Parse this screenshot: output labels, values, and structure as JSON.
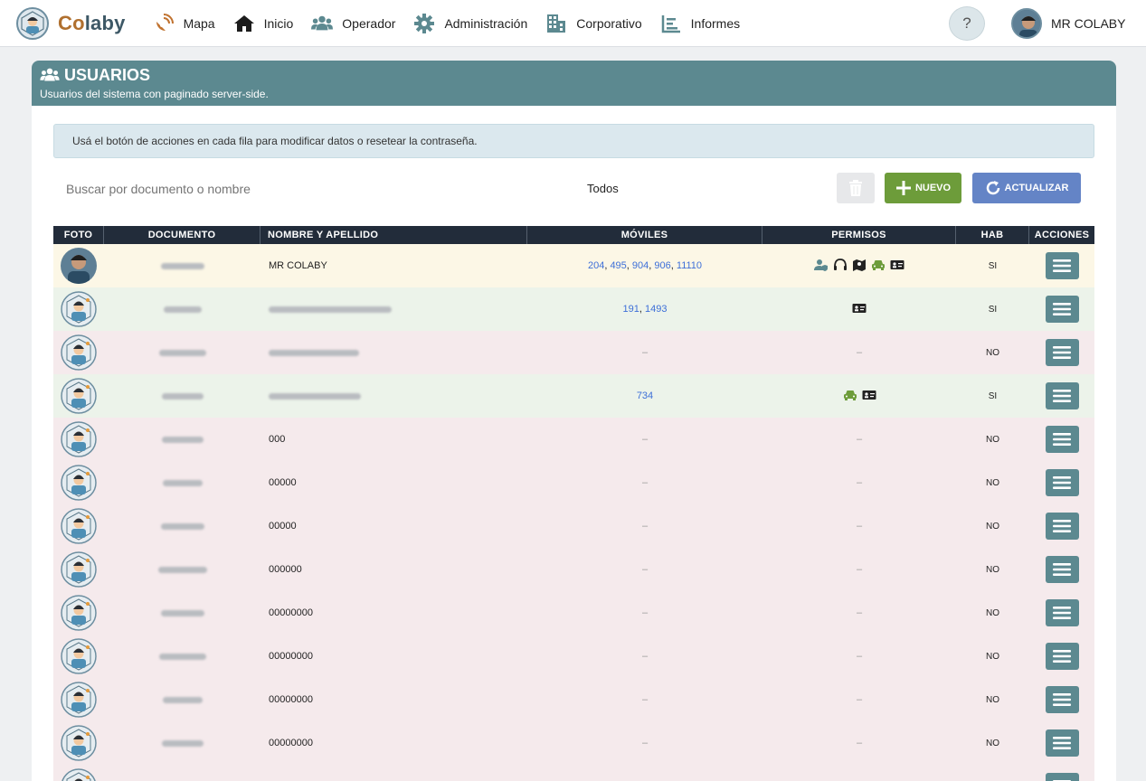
{
  "navbar": {
    "brand": {
      "part1": "Co",
      "part2": "laby"
    },
    "items": [
      {
        "label": "Mapa",
        "icon": "satellite-dish-icon"
      },
      {
        "label": "Inicio",
        "icon": "home-icon"
      },
      {
        "label": "Operador",
        "icon": "users-icon"
      },
      {
        "label": "Administración",
        "icon": "gear-icon"
      },
      {
        "label": "Corporativo",
        "icon": "building-icon"
      },
      {
        "label": "Informes",
        "icon": "chart-icon"
      }
    ],
    "help": "?",
    "user_name": "MR COLABY"
  },
  "card": {
    "title": "USUARIOS",
    "subtitle": "Usuarios del sistema con paginado server-side.",
    "alert": "Usá el botón de acciones en cada fila para modificar datos o resetear la contraseña.",
    "search_placeholder": "Buscar por documento o nombre",
    "filter": "Todos",
    "new_label": "NUEVO",
    "refresh_label": "ACTUALIZAR"
  },
  "colors": {
    "header": "#5c8990",
    "new": "#6d9c3a",
    "refresh": "#6484c6",
    "row_me": "#fcf7e6",
    "row_enabled": "#ecf3ea",
    "row_disabled": "#f5eaec"
  },
  "table": {
    "columns": [
      "FOTO",
      "DOCUMENTO",
      "NOMBRE Y APELLIDO",
      "MÓVILES",
      "PERMISOS",
      "HAB",
      "ACCIONES"
    ],
    "rows": [
      {
        "status": "me",
        "name": "MR COLABY",
        "moviles": [
          "204",
          "495",
          "904",
          "906",
          "11110"
        ],
        "permisos": [
          "user-shield-icon",
          "headset-icon",
          "map-icon",
          "car-icon",
          "id-card-icon"
        ],
        "hab": "SI"
      },
      {
        "status": "ok",
        "name": "",
        "moviles": [
          "191",
          "1493"
        ],
        "permisos": [
          "id-card-icon"
        ],
        "hab": "SI"
      },
      {
        "status": "off",
        "name": "",
        "moviles": [],
        "permisos": [],
        "hab": "NO"
      },
      {
        "status": "ok",
        "name": "",
        "moviles": [
          "734"
        ],
        "permisos": [
          "car-icon",
          "id-card-icon"
        ],
        "hab": "SI"
      },
      {
        "status": "off",
        "name": "000",
        "moviles": [],
        "permisos": [],
        "hab": "NO"
      },
      {
        "status": "off",
        "name": "00000",
        "moviles": [],
        "permisos": [],
        "hab": "NO"
      },
      {
        "status": "off",
        "name": "00000",
        "moviles": [],
        "permisos": [],
        "hab": "NO"
      },
      {
        "status": "off",
        "name": "000000",
        "moviles": [],
        "permisos": [],
        "hab": "NO"
      },
      {
        "status": "off",
        "name": "00000000",
        "moviles": [],
        "permisos": [],
        "hab": "NO"
      },
      {
        "status": "off",
        "name": "00000000",
        "moviles": [],
        "permisos": [],
        "hab": "NO"
      },
      {
        "status": "off",
        "name": "00000000",
        "moviles": [],
        "permisos": [],
        "hab": "NO"
      },
      {
        "status": "off",
        "name": "00000000",
        "moviles": [],
        "permisos": [],
        "hab": "NO"
      },
      {
        "status": "off",
        "name": "",
        "moviles": [],
        "permisos": [],
        "hab": ""
      }
    ],
    "empty_dash": "–"
  }
}
